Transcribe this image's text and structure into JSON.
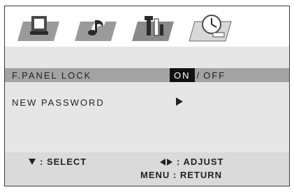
{
  "colors": {
    "menu_background": "#e6e6e6",
    "highlight_row": "#a3a3a3",
    "footer_background": "#dadada",
    "selected_option_background": "#111111",
    "text": "#222222"
  },
  "tabs": [
    {
      "name": "picture",
      "icon": "tv-icon",
      "active": false
    },
    {
      "name": "audio",
      "icon": "music-note-icon",
      "active": false
    },
    {
      "name": "setup",
      "icon": "tools-icon",
      "active": true
    },
    {
      "name": "timer",
      "icon": "clock-icon",
      "active": false
    }
  ],
  "menu": {
    "panel_lock": {
      "label": "F.PANEL LOCK",
      "on_label": "ON",
      "separator": "/",
      "off_label": "OFF",
      "selected": "ON",
      "highlighted": true
    },
    "new_password": {
      "label": "NEW PASSWORD",
      "icon": "arrow-right-icon"
    }
  },
  "footer": {
    "select_hint": ": SELECT",
    "adjust_hint": ": ADJUST",
    "return_hint": "MENU : RETURN"
  }
}
